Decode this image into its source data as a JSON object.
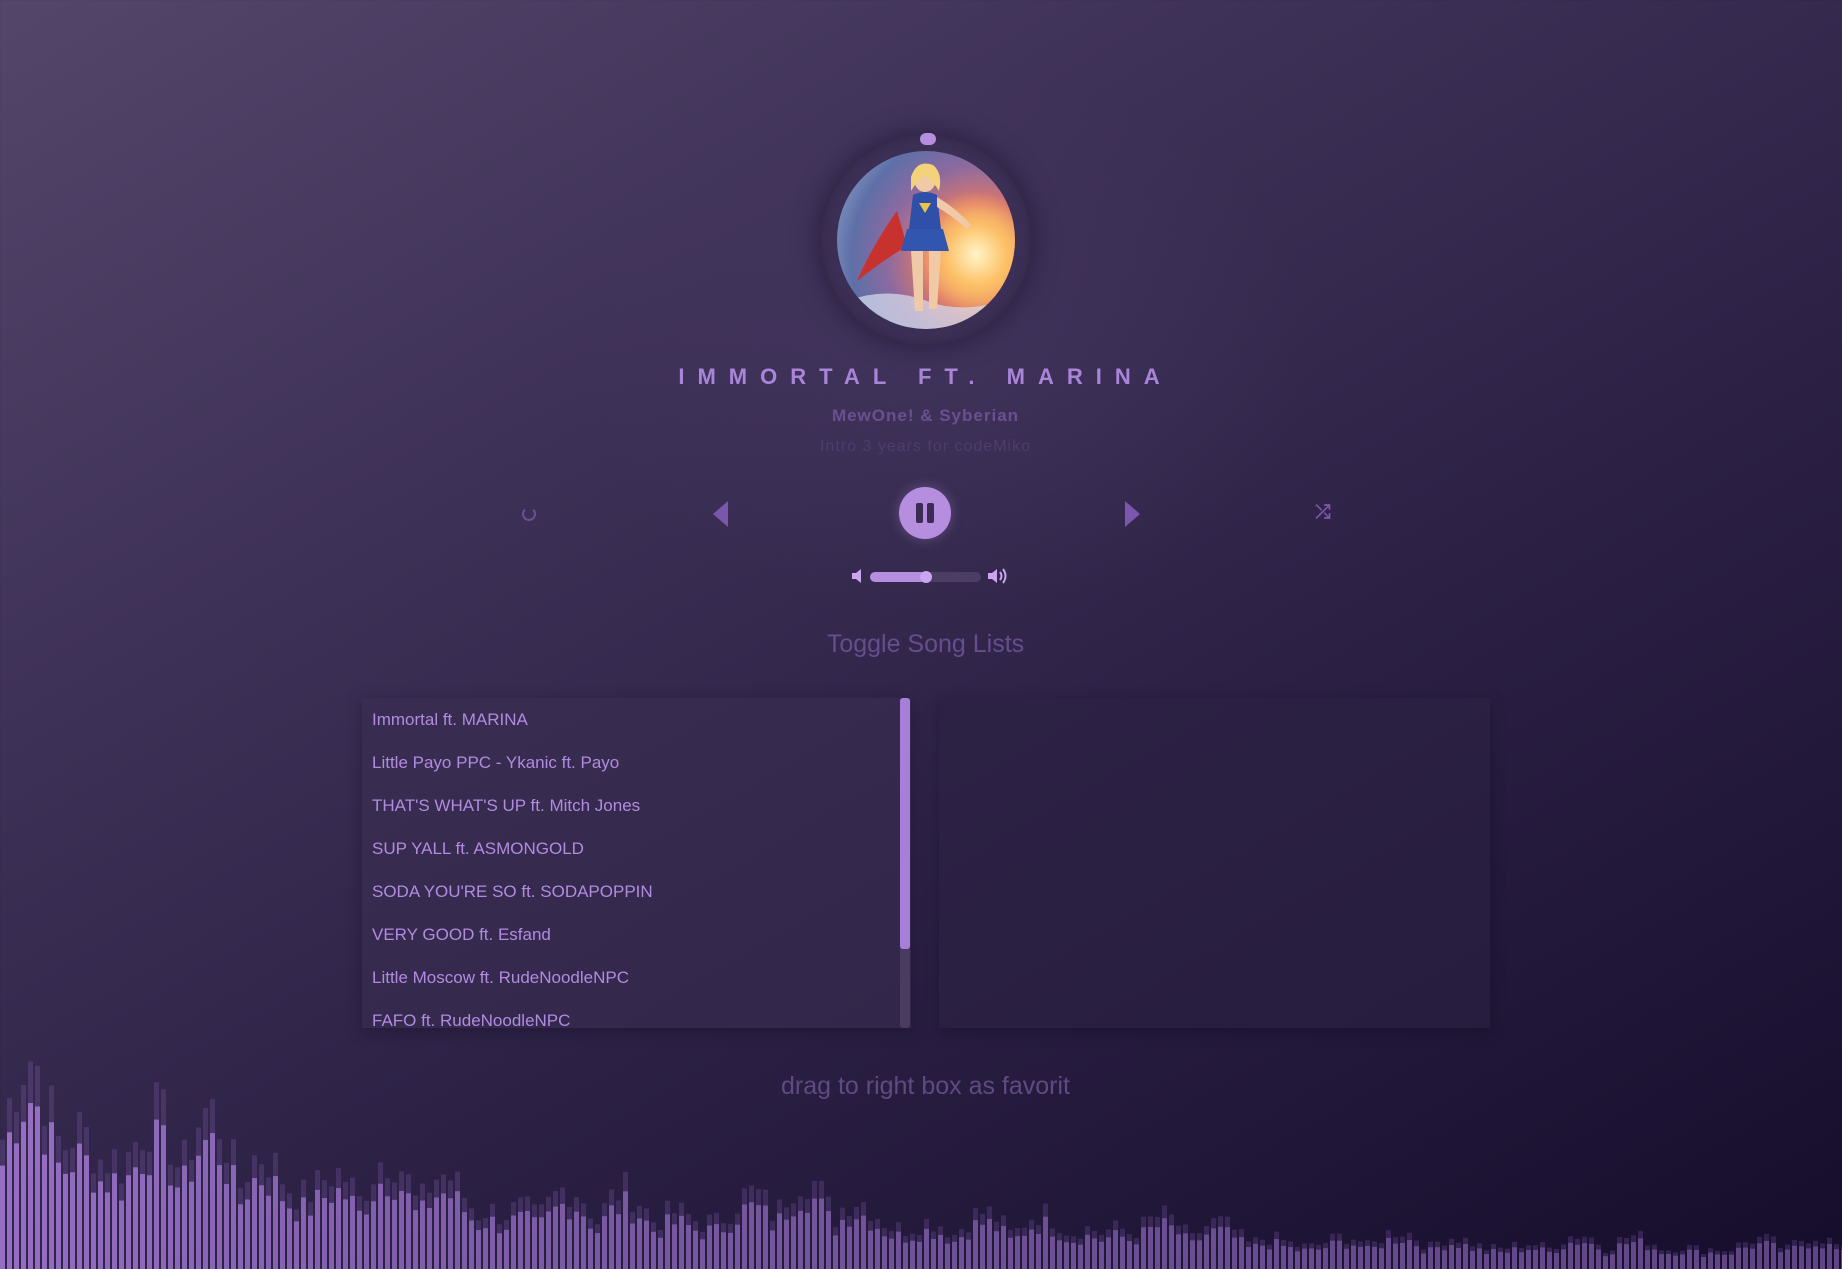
{
  "colors": {
    "accent": "#b58ee0",
    "title": "#a985d9",
    "muted": "#6a5090",
    "list_text": "#b18be0",
    "background_dark": "#160d2c",
    "background_light": "#54456a"
  },
  "player": {
    "title": "Immortal ft. MARINA",
    "artist": "MewOne! & Syberian",
    "album": "Intro 3 years for codeMiko",
    "controls": {
      "loop_icon": "loop-icon",
      "prev_icon": "previous-icon",
      "play_pause_icon": "pause-icon",
      "next_icon": "next-icon",
      "shuffle_icon": "shuffle-icon",
      "shuffle_glyph": "⤮"
    },
    "volume": {
      "level": 0.5,
      "min_icon": "volume-mute-icon",
      "max_icon": "volume-high-icon"
    }
  },
  "toggle_label": "Toggle Song Lists",
  "song_list": [
    "Immortal ft. MARINA",
    "Little Payo PPC - Ykanic ft. Payo",
    "THAT'S WHAT'S UP ft. Mitch Jones",
    "SUP YALL ft. ASMONGOLD",
    "SODA YOU'RE SO ft. SODAPOPPIN",
    "VERY GOOD ft. Esfand",
    "Little Moscow ft. RudeNoodleNPC",
    "FAFO ft. RudeNoodleNPC"
  ],
  "song_list_scroll": 0.76,
  "favorites": [],
  "hint": "drag to right box as favorit"
}
